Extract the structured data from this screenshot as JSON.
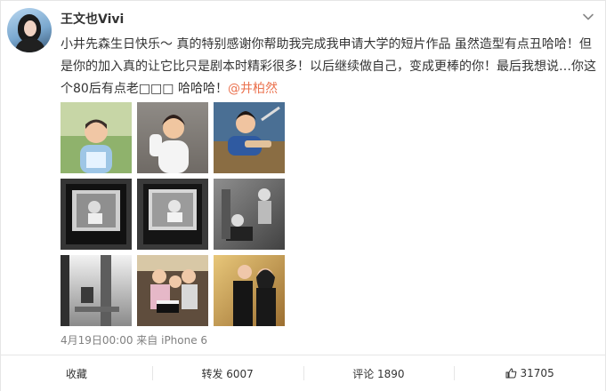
{
  "user": {
    "name": "王文也Vivi"
  },
  "post": {
    "text_main": "小井先森生日快乐～ 真的特别感谢你帮助我完成我申请大学的短片作品 虽然造型有点丑哈哈！但是你的加入真的让它比只是剧本时精彩很多！以后继续做自己，变成更棒的你！最后我想说…你这个80后有点老□□□ 哈哈哈！",
    "mention": "@井柏然"
  },
  "photos": [
    {
      "label": "photo-1"
    },
    {
      "label": "photo-2"
    },
    {
      "label": "photo-3"
    },
    {
      "label": "photo-4"
    },
    {
      "label": "photo-5"
    },
    {
      "label": "photo-6"
    },
    {
      "label": "photo-7"
    },
    {
      "label": "photo-8"
    },
    {
      "label": "photo-9"
    }
  ],
  "meta": {
    "time_source": "4月19日00:00 来自 iPhone 6"
  },
  "actions": {
    "favorite": "收藏",
    "repost": "转发 6007",
    "comment": "评论 1890",
    "like": "31705"
  },
  "icons": {
    "menu": "chevron-down-icon",
    "like": "thumbs-up-icon"
  },
  "colors": {
    "mention": "#eb7350",
    "text": "#333333",
    "muted": "#808080"
  }
}
